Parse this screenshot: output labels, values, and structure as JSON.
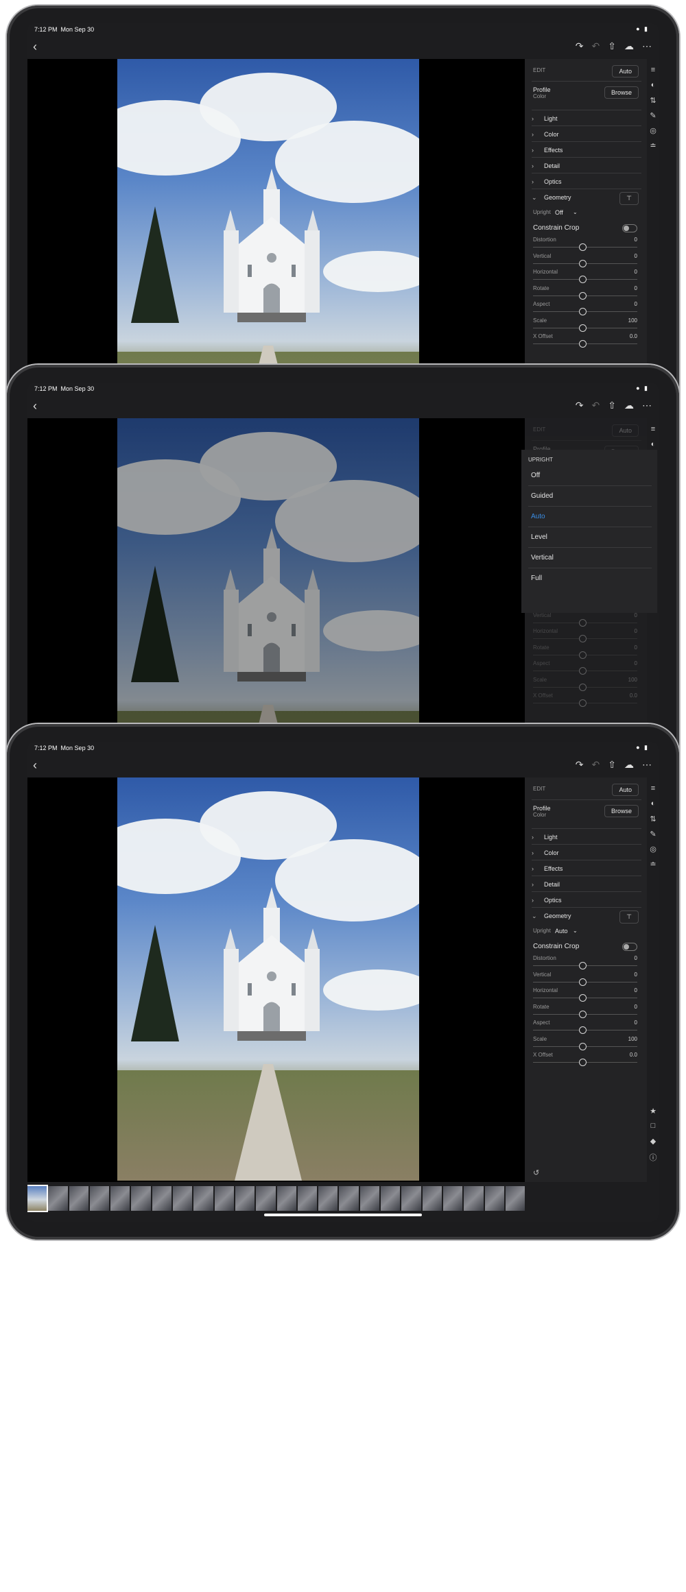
{
  "status": {
    "time": "7:12 PM",
    "date": "Mon Sep 30",
    "indicators": "● ■"
  },
  "colors": {
    "accent": "#3a8ee6",
    "panel_bg": "#232325"
  },
  "edit": {
    "header": "EDIT",
    "auto_button": "Auto",
    "profile_label": "Profile",
    "profile_value": "Color",
    "browse_button": "Browse",
    "sections": [
      "Light",
      "Color",
      "Effects",
      "Detail",
      "Optics"
    ],
    "geometry_label": "Geometry",
    "upright_label": "Upright",
    "constrain_crop": "Constrain Crop",
    "sliders": [
      {
        "label": "Distortion",
        "value": "0"
      },
      {
        "label": "Vertical",
        "value": "0"
      },
      {
        "label": "Horizontal",
        "value": "0"
      },
      {
        "label": "Rotate",
        "value": "0"
      },
      {
        "label": "Aspect",
        "value": "0"
      },
      {
        "label": "Scale",
        "value": "100"
      },
      {
        "label": "X Offset",
        "value": "0.0"
      }
    ]
  },
  "screens": [
    {
      "upright_value": "Off"
    },
    {
      "upright_value": "Auto"
    },
    {
      "upright_value": "Auto"
    }
  ],
  "upright_menu": {
    "title": "UPRIGHT",
    "options": [
      "Off",
      "Guided",
      "Auto",
      "Level",
      "Vertical",
      "Full"
    ],
    "selected": "Auto"
  }
}
